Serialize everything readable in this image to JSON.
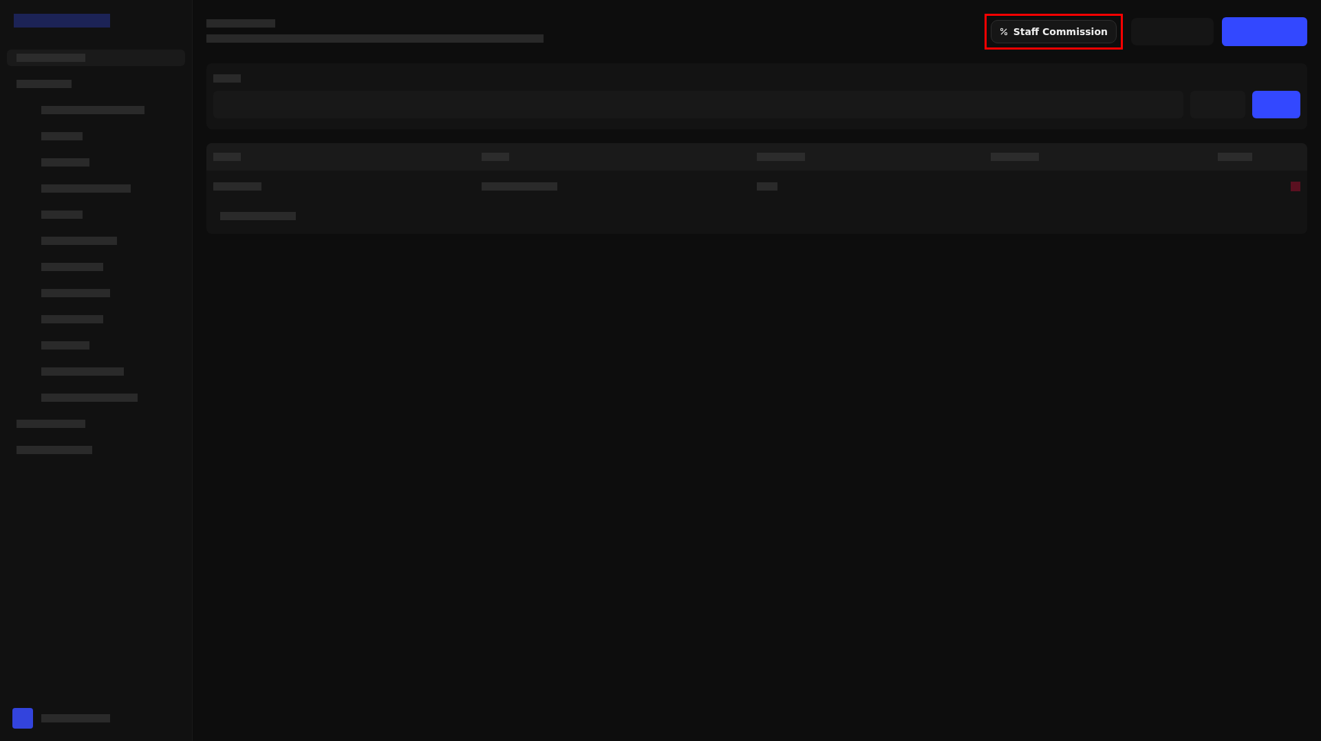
{
  "header": {
    "commission_button": {
      "label": "Staff Commission",
      "highlighted": true
    }
  }
}
